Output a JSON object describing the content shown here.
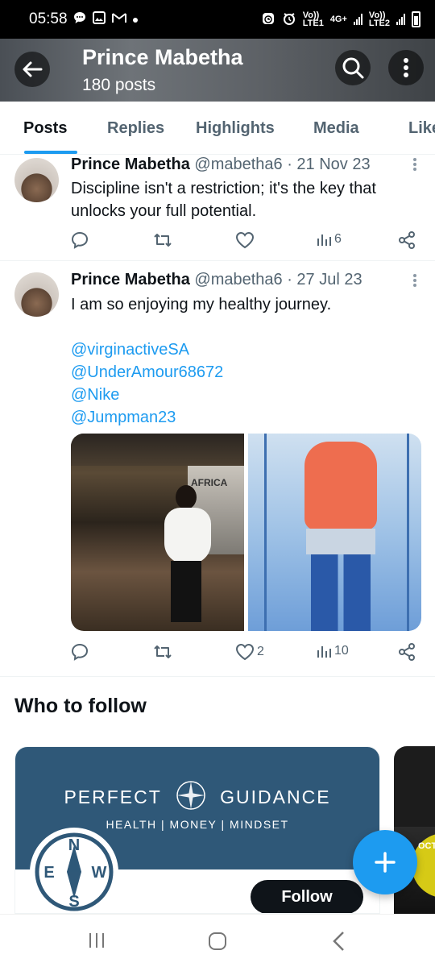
{
  "status_bar": {
    "time": "05:58",
    "notification_icons": [
      "chat-icon",
      "image-icon",
      "gmail-icon",
      "dot-icon"
    ],
    "sim1_label_top": "Vo))",
    "sim1_label_bottom": "LTE1",
    "net_label_top": "4G+",
    "sim2_label_top": "Vo))",
    "sim2_label_bottom": "LTE2"
  },
  "header": {
    "name": "Prince Mabetha",
    "posts_count": "180 posts"
  },
  "tabs": [
    {
      "label": "Posts",
      "active": true
    },
    {
      "label": "Replies"
    },
    {
      "label": "Highlights"
    },
    {
      "label": "Media"
    },
    {
      "label": "Likes"
    }
  ],
  "posts": [
    {
      "name": "Prince Mabetha",
      "handle": "@mabetha6",
      "date": "· 21 Nov 23",
      "text": "Discipline isn't a restriction; it's the key that unlocks your full potential.",
      "views": "6",
      "likes": ""
    },
    {
      "name": "Prince Mabetha",
      "handle": "@mabetha6",
      "date": "· 27 Jul 23",
      "text": "I am so enjoying my healthy journey.",
      "mentions": [
        "@virginactiveSA",
        "@UnderAmour68672",
        "@Nike",
        "@Jumpman23"
      ],
      "likes": "2",
      "views": "10",
      "photo1_sign": "AFRICA"
    }
  ],
  "who_to_follow": {
    "title": "Who to follow",
    "card": {
      "brand_left": "PERFECT",
      "brand_right": "GUIDANCE",
      "tagline": "HEALTH | MONEY | MINDSET",
      "compass_letters": [
        "N",
        "E",
        "W",
        "S"
      ],
      "follow_label": "Follow"
    },
    "card2_text": "OCT"
  },
  "colors": {
    "accent": "#1d9bf0",
    "banner": "#2f5878",
    "text": "#0f1419",
    "muted": "#536471"
  }
}
